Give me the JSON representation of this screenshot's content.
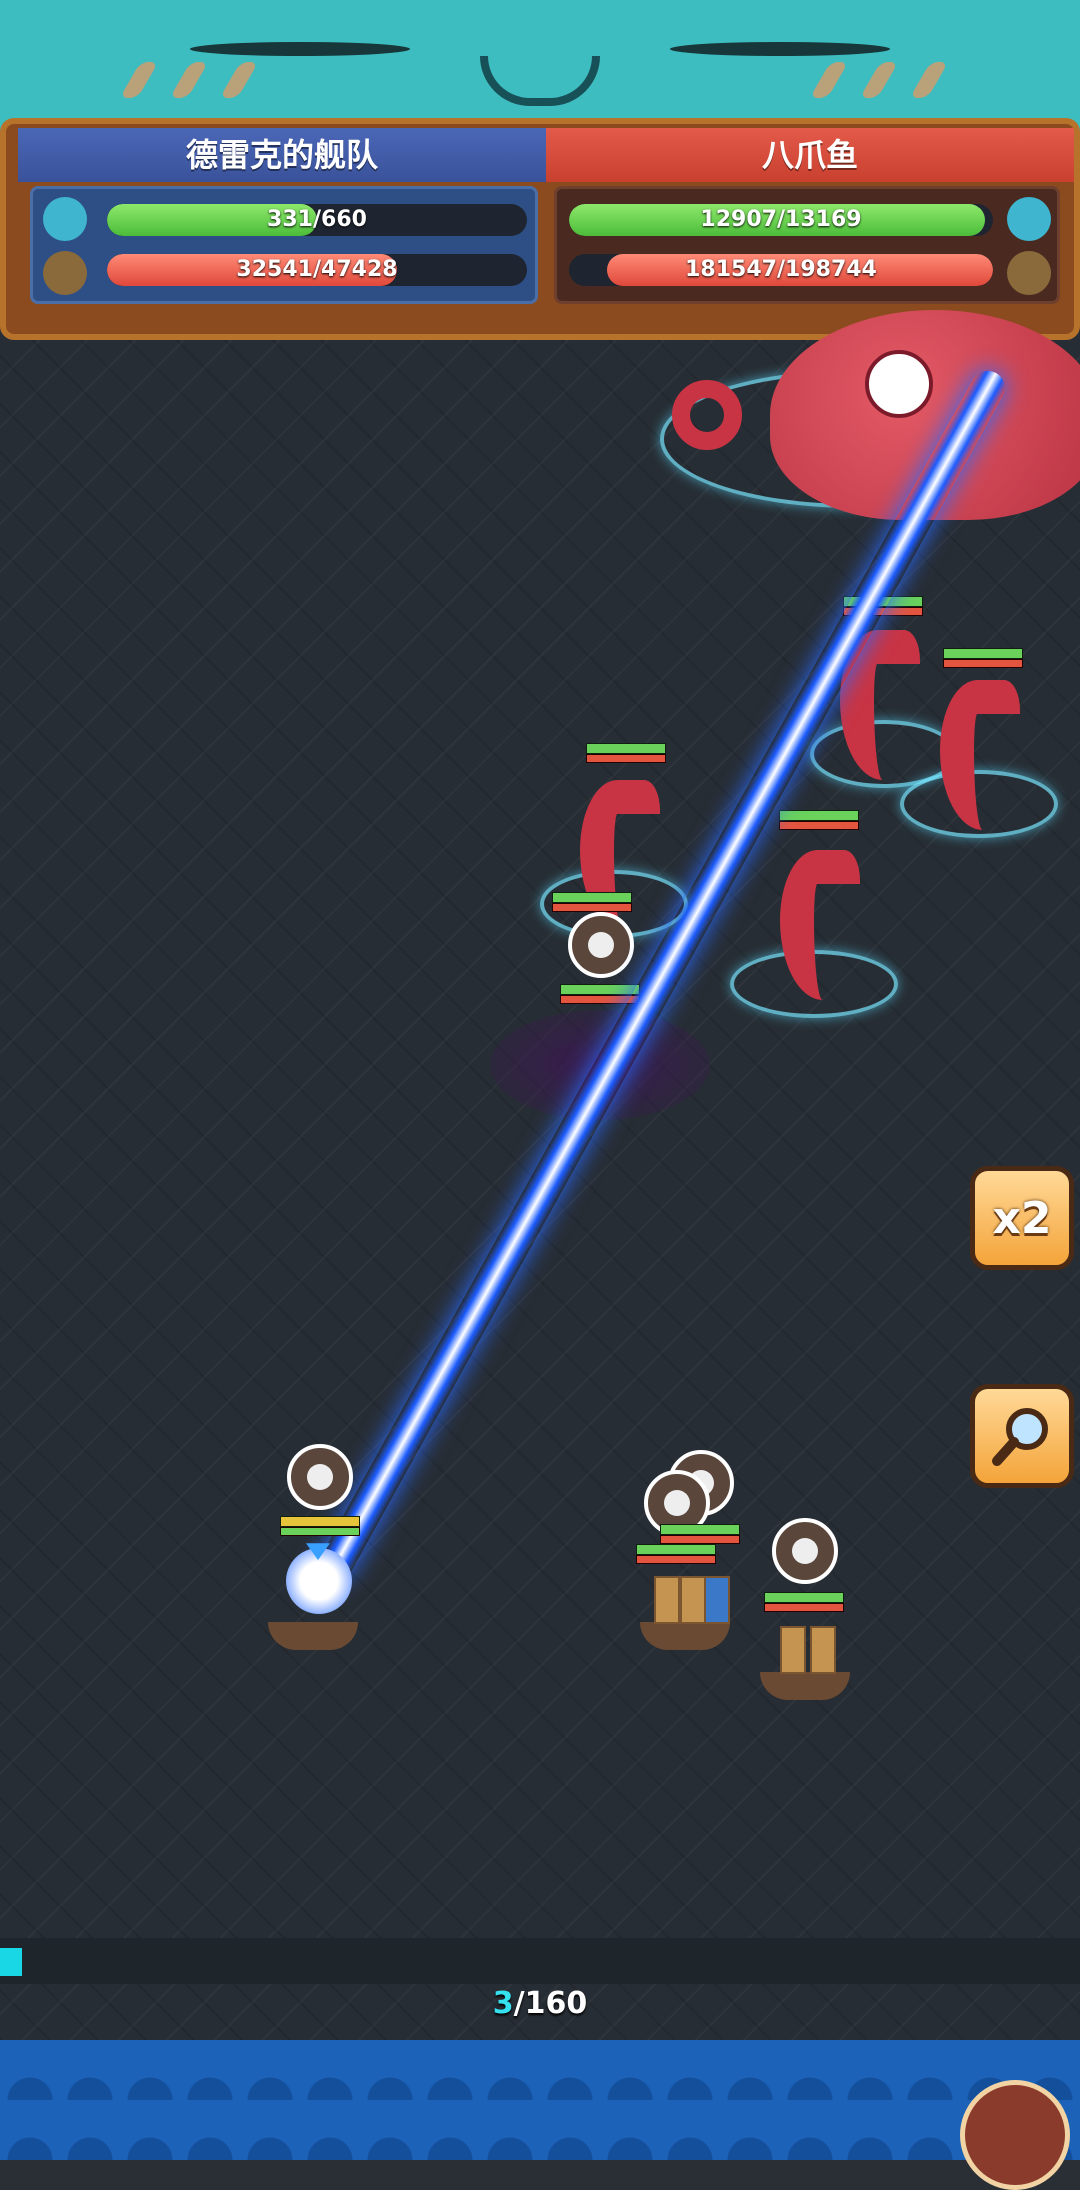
{
  "header": {
    "left_team": {
      "name": "德雷克的舰队",
      "crew": {
        "current": "331",
        "max": "660",
        "fraction": 0.5
      },
      "ship": {
        "current": "32541",
        "max": "47428",
        "fraction": 0.69
      }
    },
    "right_team": {
      "name": "八爪鱼",
      "crew": {
        "current": "12907",
        "max": "13169",
        "fraction": 0.98
      },
      "ship": {
        "current": "181547",
        "max": "198744",
        "fraction": 0.91
      }
    },
    "separator": "/"
  },
  "controls": {
    "speed_label": "x2"
  },
  "wave": {
    "current": "3",
    "separator": "/",
    "total": "160",
    "progress_fraction": 0.02
  },
  "colors": {
    "left_team": "#3a529a",
    "right_team": "#c9402f",
    "crew_bar": "#4cbc3a",
    "ship_bar": "#e0483a",
    "progress": "#19d7e5",
    "beam": "#1b5bff"
  },
  "icons": [
    "sailor-icon",
    "ship-wheel-icon",
    "magnifier-icon",
    "octopus-boss",
    "tentacle",
    "laser-beam"
  ]
}
